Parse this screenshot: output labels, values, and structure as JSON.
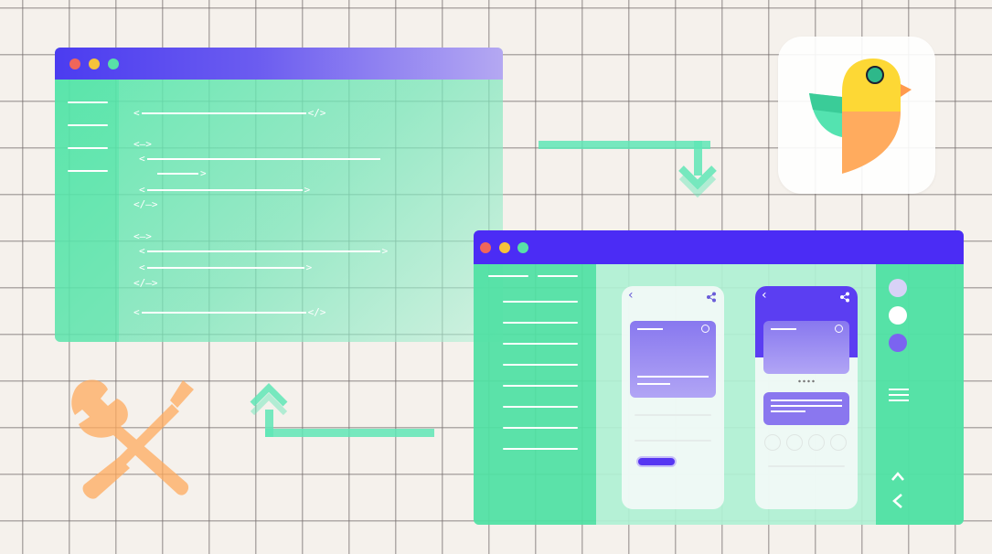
{
  "code_window": {
    "traffic_lights": [
      "#f0665a",
      "#f6c33a",
      "#58e0a8"
    ],
    "code_lines": [
      {
        "open": "<",
        "close": "</>"
      },
      {
        "open": "<—>",
        "close": ""
      },
      {
        "open": "<",
        "close": ""
      },
      {
        "open": "",
        "close": ">"
      },
      {
        "open": "<",
        "close": ">"
      },
      {
        "open": "</—>",
        "close": ""
      },
      {
        "open": "<—>",
        "close": ""
      },
      {
        "open": "<",
        "close": ">"
      },
      {
        "open": "<",
        "close": ">"
      },
      {
        "open": "</—>",
        "close": ""
      },
      {
        "open": "<",
        "close": "</>"
      }
    ]
  },
  "app_window": {
    "traffic_lights": [
      "#f0665a",
      "#f6c33a",
      "#58e0a8"
    ],
    "right_panel_colors": [
      "#d8d2f7",
      "#ffffff",
      "#7b64f0"
    ]
  },
  "icons": {
    "app_logo": "parrot-icon",
    "tools": "wrench-screwdriver-icon",
    "arrow_down": "arrow-down-icon",
    "arrow_up": "arrow-up-icon",
    "menu": "hamburger-menu-icon",
    "back": "chevron-left-icon",
    "up": "chevron-up-icon",
    "share": "share-icon"
  },
  "colors": {
    "accent_purple": "#4b2cf5",
    "accent_green": "#58e4b0",
    "accent_orange": "#ffab5e",
    "accent_yellow": "#fdd835",
    "background": "#f5f1ec"
  }
}
